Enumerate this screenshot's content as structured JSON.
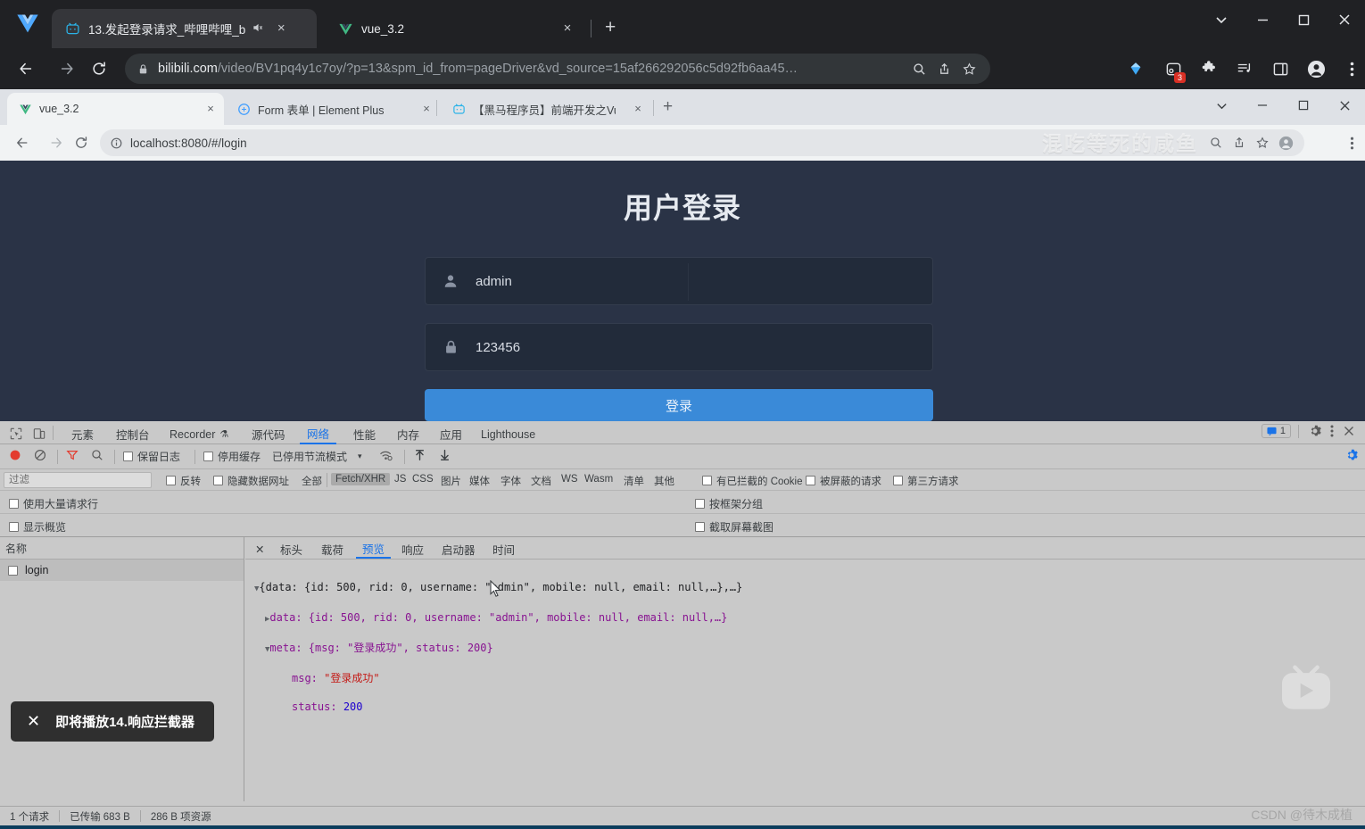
{
  "outer_browser": {
    "tabs": [
      {
        "title": "13.发起登录请求_哔哩哔哩_b",
        "favicon": "bilibili-icon",
        "muted_icon": "speaker-mute-icon",
        "close": "×",
        "active": true
      },
      {
        "title": "vue_3.2",
        "favicon": "vue-icon",
        "close": "×",
        "active": false
      }
    ],
    "new_tab_label": "+",
    "window_controls": {
      "expand": "⌄",
      "minimize": "—",
      "maximize": "▢",
      "close": "✕"
    },
    "toolbar": {
      "back": "←",
      "forward": "→",
      "reload": "⟳",
      "url_host": "bilibili.com",
      "url_path": "/video/BV1pq4y1c7oy/?p=13&spm_id_from=pageDriver&vd_source=15af266292056c5d92fb6aa45…",
      "lock_icon": "lock-icon",
      "zoom_icon": "search-zoom-icon",
      "share_icon": "share-icon",
      "bookmark_icon": "star-icon",
      "extensions": [
        {
          "name": "diamond-extension-icon",
          "badge": null
        },
        {
          "name": "screen-recorder-extension-icon",
          "badge": "3"
        },
        {
          "name": "puzzle-extensions-icon",
          "badge": null
        },
        {
          "name": "media-list-icon",
          "badge": null
        },
        {
          "name": "side-panel-icon",
          "badge": null
        },
        {
          "name": "profile-avatar-icon",
          "badge": null
        },
        {
          "name": "chrome-menu-icon",
          "badge": null
        }
      ]
    }
  },
  "inner_browser": {
    "tabs": [
      {
        "title": "vue_3.2",
        "favicon": "vue-icon",
        "close": "×",
        "active": true
      },
      {
        "title": "Form 表单 | Element Plus",
        "favicon": "element-plus-icon",
        "close": "×",
        "active": false
      },
      {
        "title": "【黑马程序员】前端开发之Vue项",
        "favicon": "bilibili-icon",
        "close": "×",
        "active": false
      }
    ],
    "new_tab_label": "+",
    "window_controls": {
      "expand": "⌄",
      "minimize": "—",
      "maximize": "▢",
      "close": "✕"
    },
    "toolbar": {
      "back": "←",
      "forward": "→",
      "reload": "⟳",
      "info_icon": "info-circle-icon",
      "url": "localhost:8080/#/login",
      "zoom_icon": "search-zoom-icon",
      "share_icon": "share-icon",
      "bookmark_icon": "star-icon",
      "profile_icon": "profile-avatar-icon",
      "menu_icon": "chrome-menu-icon"
    }
  },
  "login_page": {
    "title": "用户登录",
    "username": {
      "icon": "user-icon",
      "value": "admin"
    },
    "password": {
      "icon": "lock-icon",
      "value": "123456"
    },
    "submit_label": "登录",
    "colors": {
      "background": "#2a3346",
      "field": "#222b3a",
      "button": "#3a8ad8"
    }
  },
  "devtools": {
    "inspect_icon": "inspect-element-icon",
    "device_icon": "device-toolbar-icon",
    "panels": [
      {
        "label": "元素",
        "selected": false
      },
      {
        "label": "控制台",
        "selected": false
      },
      {
        "label": "Recorder",
        "selected": false,
        "suffix_icon": "flask-icon"
      },
      {
        "label": "源代码",
        "selected": false
      },
      {
        "label": "网络",
        "selected": true
      },
      {
        "label": "性能",
        "selected": false
      },
      {
        "label": "内存",
        "selected": false
      },
      {
        "label": "应用",
        "selected": false
      },
      {
        "label": "Lighthouse",
        "selected": false
      }
    ],
    "messages_count": "1",
    "settings_icon": "gear-icon",
    "more_icon": "kebab-menu-icon",
    "close_icon": "close-icon",
    "network_toolbar": {
      "record_icon": "record-circle-icon",
      "clear_icon": "clear-no-entry-icon",
      "filter_icon": "funnel-filter-icon",
      "search_icon": "search-icon",
      "preserve_log": "保留日志",
      "disable_cache": "停用缓存",
      "throttling": "已停用节流模式",
      "dropdown_caret": "▾",
      "wifi_icon": "network-conditions-icon",
      "import_icon": "import-har-icon",
      "export_icon": "export-har-icon",
      "settings_icon": "gear-icon"
    },
    "filter_row": {
      "placeholder": "过滤",
      "invert": "反转",
      "hide_data_urls": "隐藏数据网址",
      "types": [
        "全部",
        "Fetch/XHR",
        "JS",
        "CSS",
        "图片",
        "媒体",
        "字体",
        "文档",
        "WS",
        "Wasm",
        "清单",
        "其他"
      ],
      "selected_type": "Fetch/XHR",
      "blocked_cookies": "有已拦截的 Cookie",
      "blocked_requests": "被屏蔽的请求",
      "third_party": "第三方请求"
    },
    "options": {
      "big_request_rows": "使用大量请求行",
      "group_by_frame": "按框架分组",
      "show_overview": "显示概览",
      "capture_screenshots": "截取屏幕截图"
    },
    "requests": {
      "column_header": "名称",
      "rows": [
        {
          "name": "login"
        }
      ]
    },
    "detail_tabs": [
      {
        "label": "标头",
        "selected": false
      },
      {
        "label": "载荷",
        "selected": false
      },
      {
        "label": "预览",
        "selected": true
      },
      {
        "label": "响应",
        "selected": false
      },
      {
        "label": "启动器",
        "selected": false
      },
      {
        "label": "时间",
        "selected": false
      }
    ],
    "detail_close": "✕",
    "preview_json": {
      "root_line": "{data: {id: 500, rid: 0, username: \"admin\", mobile: null, email: null,…},…}",
      "data_line": "data: {id: 500, rid: 0, username: \"admin\", mobile: null, email: null,…}",
      "meta_line": "meta: {msg: \"登录成功\", status: 200}",
      "msg_key": "msg:",
      "msg_value": "\"登录成功\"",
      "status_key": "status:",
      "status_value": "200"
    },
    "status_bar": {
      "requests": "1 个请求",
      "transferred": "已传输 683 B",
      "resources": "286 B 项资源"
    }
  },
  "overlays": {
    "toast": {
      "close_icon": "close-icon",
      "text": "即将播放14.响应拦截器"
    },
    "url_watermark": "混吃等死的咸鱼",
    "play_watermark": "bilibili-play-icon",
    "csdn_watermark": "CSDN @待木成植"
  }
}
